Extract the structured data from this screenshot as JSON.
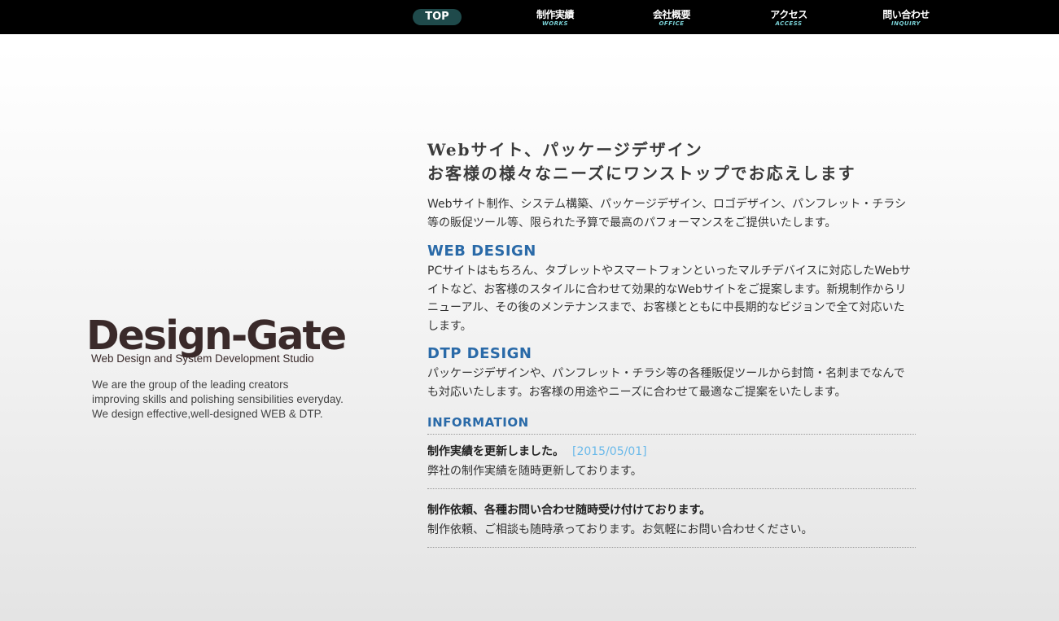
{
  "nav": {
    "items": [
      {
        "jp": "TOP",
        "en": ""
      },
      {
        "jp": "制作実績",
        "en": "WORKS"
      },
      {
        "jp": "会社概要",
        "en": "OFFICE"
      },
      {
        "jp": "アクセス",
        "en": "ACCESS"
      },
      {
        "jp": "問い合わせ",
        "en": "INQUIRY"
      }
    ]
  },
  "logo": {
    "main": "Design-Gate",
    "sub": "Web Design and System Development Studio"
  },
  "tagline": {
    "line1": "We are the group of the leading creators",
    "line2": "improving skills and polishing sensibilities everyday.",
    "line3": "We design effective,well-designed WEB & DTP."
  },
  "main": {
    "headline1": "Webサイト、パッケージデザイン",
    "headline2": "お客様の様々なニーズにワンストップでお応えします",
    "lead": "Webサイト制作、システム構築、パッケージデザイン、ロゴデザイン、パンフレット・チラシ等の販促ツール等、限られた予算で最高のパフォーマンスをご提供いたします。",
    "web_title": "WEB DESIGN",
    "web_body": "PCサイトはもちろん、タブレットやスマートフォンといったマルチデバイスに対応したWebサイトなど、お客様のスタイルに合わせて効果的なWebサイトをご提案します。新規制作からリニューアル、その後のメンテナンスまで、お客様とともに中長期的なビジョンで全て対応いたします。",
    "dtp_title": "DTP DESIGN",
    "dtp_body": "パッケージデザインや、パンフレット・チラシ等の各種販促ツールから封筒・名刺までなんでも対応いたします。お客様の用途やニーズに合わせて最適なご提案をいたします。"
  },
  "information": {
    "title": "INFORMATION",
    "items": [
      {
        "title": "制作実績を更新しました。",
        "date": "[2015/05/01]",
        "body": "弊社の制作実績を随時更新しております。"
      },
      {
        "title": "制作依頼、各種お問い合わせ随時受け付けております。",
        "date": "",
        "body": "制作依頼、ご相談も随時承っております。お気軽にお問い合わせください。"
      }
    ]
  },
  "colors": {
    "topbar": "#000000",
    "accent_blue": "#2a6aa8",
    "date_blue": "#69b9ea",
    "nav_sub": "#7ad1d6",
    "top_pill": "#1f4a4b"
  }
}
